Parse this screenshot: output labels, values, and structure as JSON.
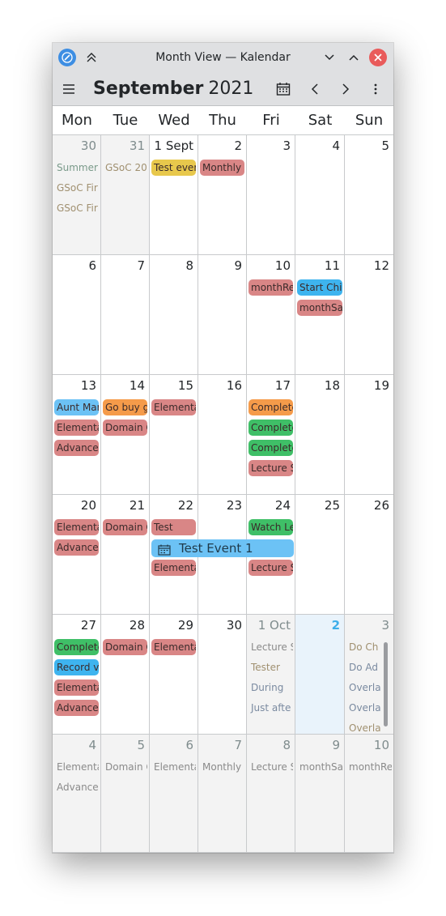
{
  "window": {
    "title": "Month View — Kalendar"
  },
  "toolbar": {
    "month": "September",
    "year": "2021"
  },
  "weekdays": [
    "Mon",
    "Tue",
    "Wed",
    "Thu",
    "Fri",
    "Sat",
    "Sun"
  ],
  "colors": {
    "red": "#d98686",
    "yellow": "#e8c84c",
    "green": "#3fbf67",
    "blue": "#3eb4ef",
    "orange": "#f59b4a",
    "lightblue": "#6cc2f5",
    "today": "#3daee9"
  },
  "weeks": [
    {
      "days": [
        {
          "label": "30",
          "out": true,
          "events": [
            {
              "title": "Summer",
              "style": "plain",
              "color": "#7a9a8a"
            },
            {
              "title": "GSoC Fir",
              "style": "plain",
              "color": "#a09070"
            },
            {
              "title": "GSoC Fir",
              "style": "plain",
              "color": "#a09070"
            }
          ]
        },
        {
          "label": "31",
          "out": true,
          "events": [
            {
              "title": "GSoC 20",
              "style": "plain",
              "color": "#a09070"
            }
          ]
        },
        {
          "label": "1 Sept",
          "out": false,
          "events": [
            {
              "title": "Test ever",
              "color": "yellow"
            }
          ]
        },
        {
          "label": "2",
          "out": false,
          "events": [
            {
              "title": "Monthly «",
              "color": "red"
            }
          ]
        },
        {
          "label": "3",
          "out": false,
          "events": []
        },
        {
          "label": "4",
          "out": false,
          "events": []
        },
        {
          "label": "5",
          "out": false,
          "events": []
        }
      ]
    },
    {
      "days": [
        {
          "label": "6",
          "out": false,
          "events": []
        },
        {
          "label": "7",
          "out": false,
          "events": []
        },
        {
          "label": "8",
          "out": false,
          "events": []
        },
        {
          "label": "9",
          "out": false,
          "events": []
        },
        {
          "label": "10",
          "out": false,
          "events": [
            {
              "title": "monthRe",
              "color": "red"
            }
          ]
        },
        {
          "label": "11",
          "out": false,
          "events": [
            {
              "title": "Start Chi",
              "color": "blue"
            },
            {
              "title": "monthSa",
              "color": "red"
            }
          ]
        },
        {
          "label": "12",
          "out": false,
          "events": []
        }
      ]
    },
    {
      "days": [
        {
          "label": "13",
          "out": false,
          "events": [
            {
              "title": "Aunt Mar",
              "color": "lightblue"
            },
            {
              "title": "Elementa",
              "color": "red"
            },
            {
              "title": "Advance",
              "color": "red"
            }
          ]
        },
        {
          "label": "14",
          "out": false,
          "events": [
            {
              "title": "Go buy g",
              "color": "orange"
            },
            {
              "title": "Domain C",
              "color": "red"
            }
          ]
        },
        {
          "label": "15",
          "out": false,
          "events": [
            {
              "title": "Elementa",
              "color": "red"
            }
          ]
        },
        {
          "label": "16",
          "out": false,
          "events": []
        },
        {
          "label": "17",
          "out": false,
          "events": [
            {
              "title": "Complete",
              "color": "orange"
            },
            {
              "title": "Complete",
              "color": "green"
            },
            {
              "title": "Complete",
              "color": "green"
            },
            {
              "title": "Lecture S",
              "color": "red"
            }
          ]
        },
        {
          "label": "18",
          "out": false,
          "events": []
        },
        {
          "label": "19",
          "out": false,
          "events": []
        }
      ]
    },
    {
      "days": [
        {
          "label": "20",
          "out": false,
          "events": [
            {
              "title": "Elementa",
              "color": "red"
            },
            {
              "title": "Advance",
              "color": "red"
            }
          ]
        },
        {
          "label": "21",
          "out": false,
          "events": [
            {
              "title": "Domain C",
              "color": "red"
            }
          ]
        },
        {
          "label": "22",
          "out": false,
          "events": [
            {
              "title": "Test",
              "color": "red"
            },
            {
              "title": "",
              "color": "none"
            },
            {
              "title": "Elementa",
              "color": "red"
            }
          ]
        },
        {
          "label": "23",
          "out": false,
          "events": []
        },
        {
          "label": "24",
          "out": false,
          "events": [
            {
              "title": "Watch Le",
              "color": "green"
            },
            {
              "title": "",
              "color": "none"
            },
            {
              "title": "Lecture S",
              "color": "red"
            }
          ]
        },
        {
          "label": "25",
          "out": false,
          "events": []
        },
        {
          "label": "26",
          "out": false,
          "events": []
        }
      ],
      "multi": {
        "title": "Test Event 1",
        "from": 2,
        "to": 4,
        "row": 1
      }
    },
    {
      "days": [
        {
          "label": "27",
          "out": false,
          "events": [
            {
              "title": "Complete",
              "color": "green"
            },
            {
              "title": "Record v",
              "color": "blue"
            },
            {
              "title": "Elementa",
              "color": "red"
            },
            {
              "title": "Advance",
              "color": "red"
            }
          ]
        },
        {
          "label": "28",
          "out": false,
          "events": [
            {
              "title": "Domain C",
              "color": "red"
            }
          ]
        },
        {
          "label": "29",
          "out": false,
          "events": [
            {
              "title": "Elementa",
              "color": "red"
            }
          ]
        },
        {
          "label": "30",
          "out": false,
          "events": []
        },
        {
          "label": "1 Oct",
          "out": true,
          "events": [
            {
              "title": "Lecture S",
              "style": "plain",
              "color": "#8a8a8a"
            },
            {
              "title": "Tester",
              "style": "plain",
              "color": "#a09070"
            },
            {
              "title": "During",
              "style": "plain",
              "color": "#7a8aa0"
            },
            {
              "title": "Just afte",
              "style": "plain",
              "color": "#7a8aa0"
            }
          ]
        },
        {
          "label": "2",
          "out": false,
          "today": true,
          "events": []
        },
        {
          "label": "3",
          "out": true,
          "events": [
            {
              "title": "Do Ch",
              "style": "plain",
              "color": "#a09070"
            },
            {
              "title": "Do Ad",
              "style": "plain",
              "color": "#7a8aa0"
            },
            {
              "title": "Overla",
              "style": "plain",
              "color": "#7a8aa0"
            },
            {
              "title": "Overla",
              "style": "plain",
              "color": "#7a8aa0"
            },
            {
              "title": "Overla",
              "style": "plain",
              "color": "#a09070"
            }
          ]
        }
      ]
    },
    {
      "days": [
        {
          "label": "4",
          "out": true,
          "events": [
            {
              "title": "Elementa",
              "style": "plain",
              "color": "#8a8a8a"
            },
            {
              "title": "Advance",
              "style": "plain",
              "color": "#8a8a8a"
            }
          ]
        },
        {
          "label": "5",
          "out": true,
          "events": [
            {
              "title": "Domain C",
              "style": "plain",
              "color": "#8a8a8a"
            }
          ]
        },
        {
          "label": "6",
          "out": true,
          "events": [
            {
              "title": "Elementa",
              "style": "plain",
              "color": "#8a8a8a"
            }
          ]
        },
        {
          "label": "7",
          "out": true,
          "events": [
            {
              "title": "Monthly «",
              "style": "plain",
              "color": "#8a8a8a"
            }
          ]
        },
        {
          "label": "8",
          "out": true,
          "events": [
            {
              "title": "Lecture S",
              "style": "plain",
              "color": "#8a8a8a"
            }
          ]
        },
        {
          "label": "9",
          "out": true,
          "events": [
            {
              "title": "monthSa",
              "style": "plain",
              "color": "#8a8a8a"
            }
          ]
        },
        {
          "label": "10",
          "out": true,
          "events": [
            {
              "title": "monthRe",
              "style": "plain",
              "color": "#8a8a8a"
            }
          ]
        }
      ]
    }
  ]
}
